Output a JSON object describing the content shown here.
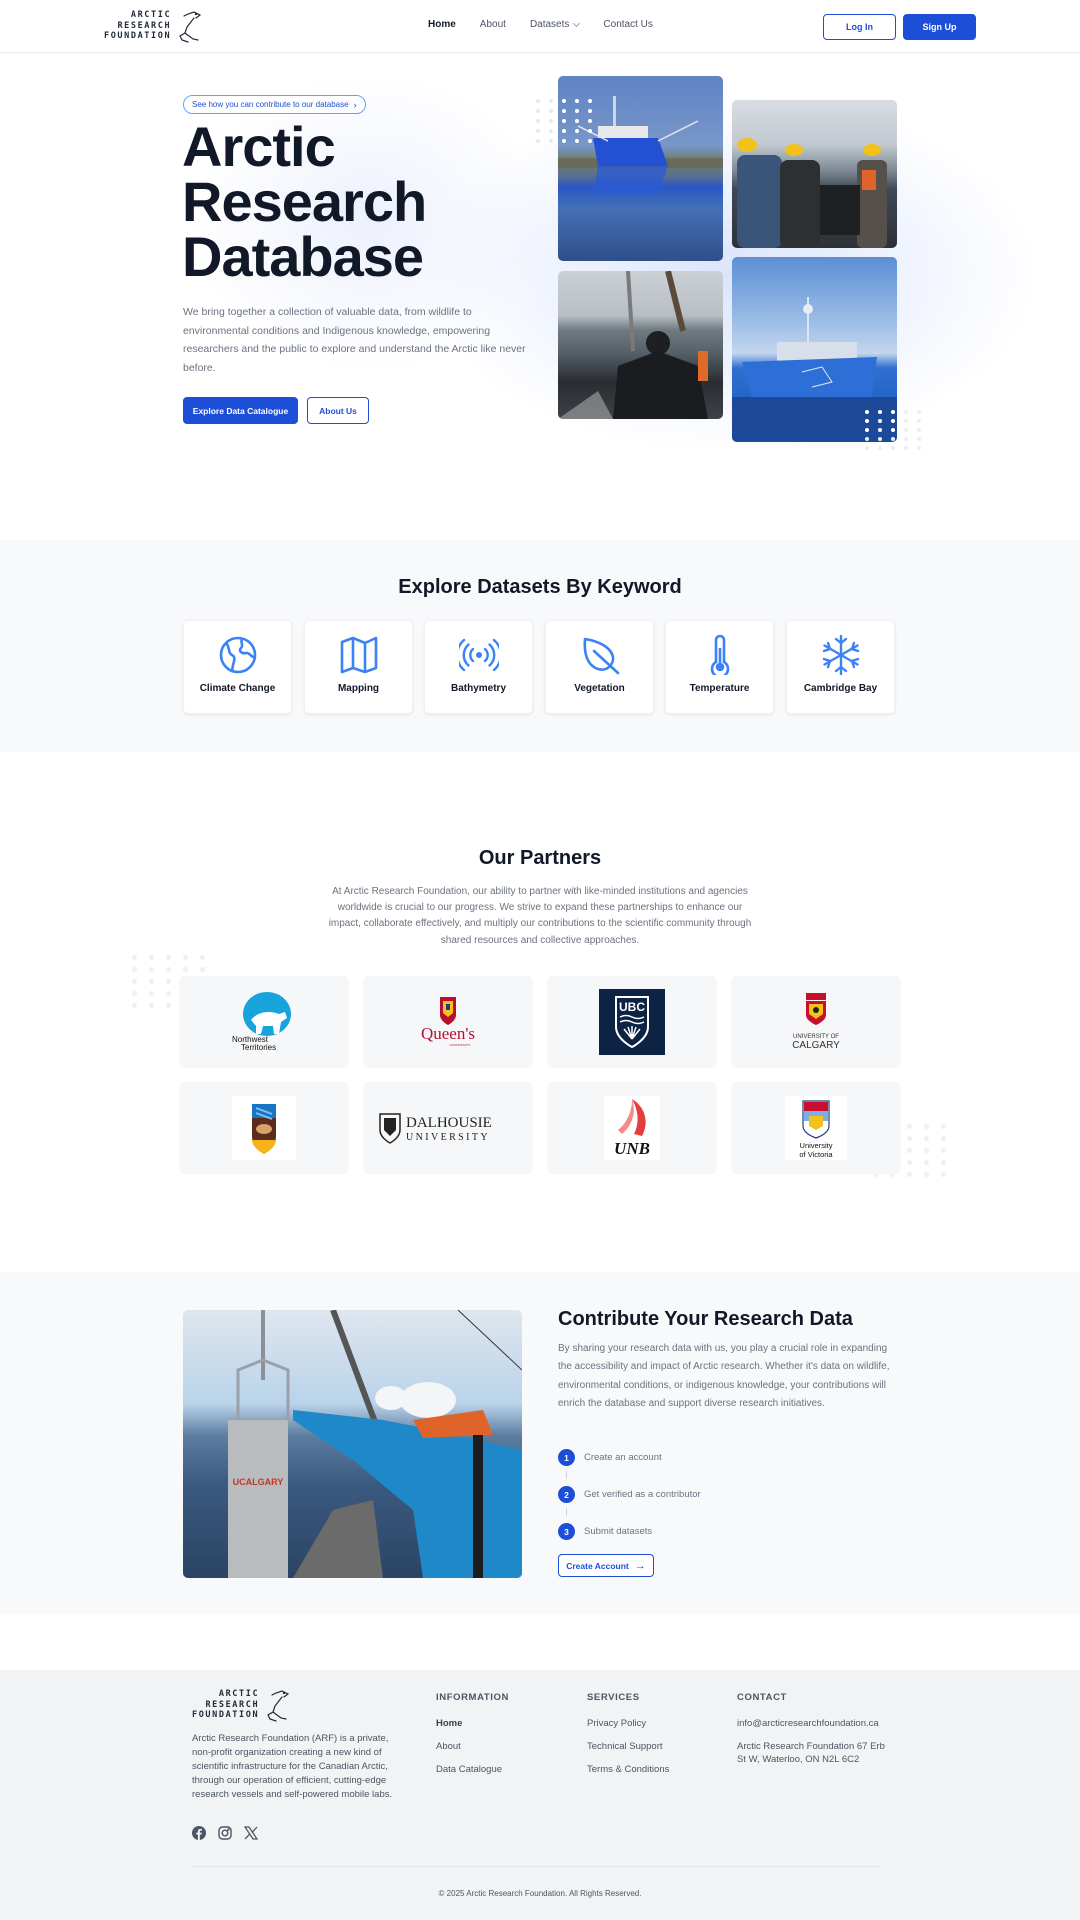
{
  "brand": {
    "logo_lines": [
      "ARCTIC",
      "RESEARCH",
      "FOUNDATION"
    ],
    "logo_icon": "polar-bear-outline-icon"
  },
  "nav": {
    "links": [
      {
        "label": "Home",
        "active": true
      },
      {
        "label": "About",
        "active": false
      },
      {
        "label": "Datasets",
        "active": false,
        "has_dropdown": true
      },
      {
        "label": "Contact Us",
        "active": false
      }
    ],
    "login_label": "Log In",
    "signup_label": "Sign Up"
  },
  "hero": {
    "pill_label": "See how you can contribute to our database",
    "pill_icon": "chevron-right-icon",
    "title_lines": [
      "Arctic",
      "Research",
      "Database"
    ],
    "description": "We bring together a collection of valuable data, from wildlife to environmental conditions and Indigenous knowledge, empowering researchers and the public to explore and understand the Arctic like never before.",
    "primary_button": "Explore Data Catalogue",
    "secondary_button": "About Us",
    "photos": [
      {
        "alt": "Research vessel reflected in calm water"
      },
      {
        "alt": "Researchers in hard hats on deck"
      },
      {
        "alt": "Researcher lowering equipment over the side"
      },
      {
        "alt": "Blue research ship at sea"
      }
    ]
  },
  "datasets": {
    "title": "Explore Datasets By Keyword",
    "keywords": [
      {
        "label": "Climate Change",
        "icon": "globe-icon"
      },
      {
        "label": "Mapping",
        "icon": "map-icon"
      },
      {
        "label": "Bathymetry",
        "icon": "signal-waves-icon"
      },
      {
        "label": "Vegetation",
        "icon": "leaf-icon"
      },
      {
        "label": "Temperature",
        "icon": "thermometer-icon"
      },
      {
        "label": "Cambridge Bay",
        "icon": "snowflake-icon"
      }
    ],
    "accent_color": "#3b82f6"
  },
  "partners": {
    "title": "Our Partners",
    "description": "At Arctic Research Foundation, our ability to partner with like-minded institutions and agencies worldwide is crucial to our progress. We strive to expand these partnerships to enhance our impact, collaborate effectively, and multiply our contributions to the scientific community through shared resources and collective approaches.",
    "logos": [
      {
        "name": "Northwest Territories",
        "text": [
          "Northwest",
          "Territories"
        ]
      },
      {
        "name": "Queen's University",
        "text": [
          "Queen's",
          "UNIVERSITY"
        ]
      },
      {
        "name": "UBC",
        "text": [
          "UBC"
        ]
      },
      {
        "name": "University of Calgary",
        "text": [
          "UNIVERSITY OF",
          "CALGARY"
        ]
      },
      {
        "name": "University of Manitoba",
        "text": []
      },
      {
        "name": "Dalhousie University",
        "text": [
          "DALHOUSIE",
          "UNIVERSITY"
        ]
      },
      {
        "name": "UNB",
        "text": [
          "UNB"
        ]
      },
      {
        "name": "University of Victoria",
        "text": [
          "University",
          "of Victoria"
        ]
      }
    ]
  },
  "contribute": {
    "title": "Contribute Your Research Data",
    "description": "By sharing your research data with us, you play a crucial role in expanding the accessibility and impact of Arctic research. Whether it's data on wildlife, environmental conditions, or indigenous knowledge, your contributions will enrich the database and support diverse research initiatives.",
    "steps": [
      {
        "num": "1",
        "label": "Create an account"
      },
      {
        "num": "2",
        "label": "Get verified as a contributor"
      },
      {
        "num": "3",
        "label": "Submit datasets"
      }
    ],
    "button_label": "Create Account",
    "photo_label": "UCALGARY"
  },
  "footer": {
    "description": "Arctic Research Foundation (ARF) is a private, non-profit organization creating a new kind of scientific infrastructure for the Canadian Arctic, through our operation of efficient, cutting-edge research vessels and self-powered mobile labs.",
    "social": [
      "facebook-icon",
      "instagram-icon",
      "x-icon"
    ],
    "columns": [
      {
        "heading": "INFORMATION",
        "links": [
          "Home",
          "About",
          "Data Catalogue"
        ]
      },
      {
        "heading": "SERVICES",
        "links": [
          "Privacy Policy",
          "Technical Support",
          "Terms & Conditions"
        ]
      },
      {
        "heading": "CONTACT",
        "links": [
          "info@arcticresearchfoundation.ca",
          "Arctic Research Foundation 67 Erb St W, Waterloo, ON N2L 6C2"
        ]
      }
    ],
    "copyright": "© 2025 Arctic Research Foundation. All Rights Reserved."
  },
  "colors": {
    "primary": "#1d4ed8",
    "icon_blue": "#3b82f6",
    "heading": "#111827",
    "body_text": "#6b7280",
    "section_bg": "#f8f9fb",
    "footer_bg": "#f2f3f5"
  }
}
